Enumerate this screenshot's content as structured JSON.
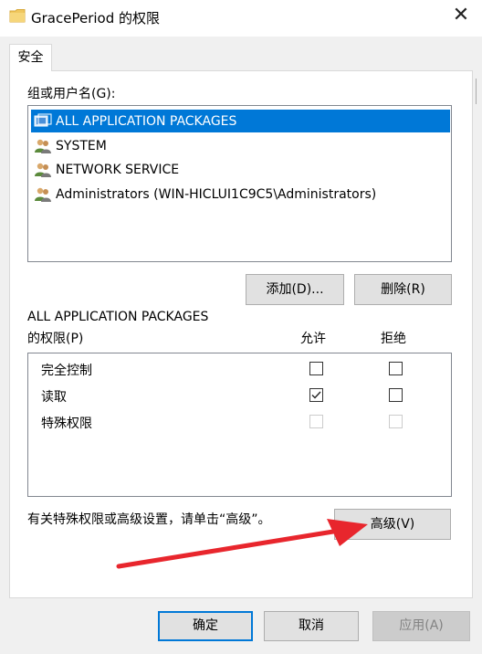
{
  "window": {
    "title": "GracePeriod 的权限",
    "close_glyph": "✕",
    "title_icon": "folder-icon"
  },
  "tabs": [
    {
      "label": "安全",
      "active": true
    }
  ],
  "group_label": "组或用户名(G):",
  "principals": [
    {
      "name": "ALL APPLICATION PACKAGES",
      "icon": "app-packages-icon",
      "selected": true
    },
    {
      "name": "SYSTEM",
      "icon": "users-icon",
      "selected": false
    },
    {
      "name": "NETWORK SERVICE",
      "icon": "users-icon",
      "selected": false
    },
    {
      "name": "Administrators (WIN-HICLUI1C9C5\\Administrators)",
      "icon": "users-icon",
      "selected": false
    }
  ],
  "buttons": {
    "add": "添加(D)...",
    "remove": "删除(R)",
    "advanced": "高级(V)",
    "ok": "确定",
    "cancel": "取消",
    "apply": "应用(A)"
  },
  "permissions": {
    "for_name": "ALL APPLICATION PACKAGES",
    "label": "的权限(P)",
    "col_allow": "允许",
    "col_deny": "拒绝",
    "rows": [
      {
        "name": "完全控制",
        "allow": false,
        "deny": false,
        "disabled": false
      },
      {
        "name": "读取",
        "allow": true,
        "deny": false,
        "disabled": false
      },
      {
        "name": "特殊权限",
        "allow": false,
        "deny": false,
        "disabled": true
      }
    ]
  },
  "hint": "有关特殊权限或高级设置，请单击“高级”。",
  "colors": {
    "selection": "#0078d7",
    "annotation_arrow": "#e8262d",
    "folder": "#f0c75e"
  }
}
